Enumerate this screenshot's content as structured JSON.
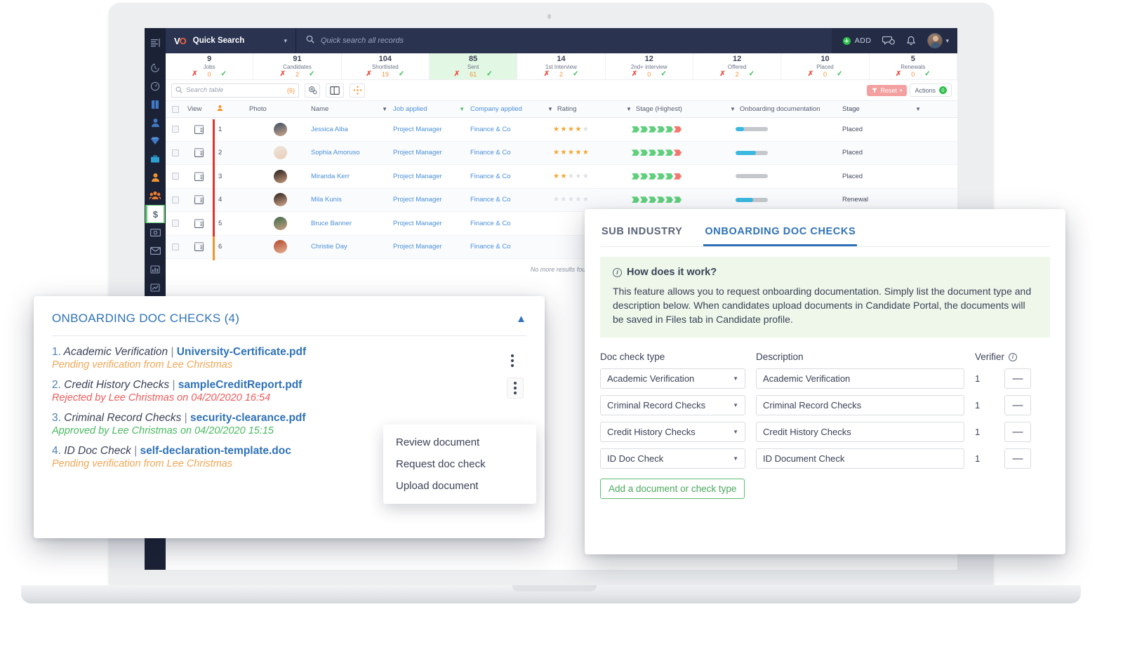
{
  "app": {
    "logo": "VO",
    "quick_search_label": "Quick Search",
    "quick_search_caret": "chevron-down-icon",
    "global_search_placeholder": "Quick search all records",
    "add_label": "ADD"
  },
  "sidebar": {
    "items": [
      {
        "name": "menu-toggle",
        "icon": "hamburger-icon"
      },
      {
        "name": "history",
        "icon": "clock-history-icon"
      },
      {
        "name": "dashboard",
        "icon": "speedometer-icon"
      },
      {
        "name": "jobs",
        "icon": "book-icon"
      },
      {
        "name": "contacts",
        "icon": "person-icon"
      },
      {
        "name": "deals",
        "icon": "diamond-icon"
      },
      {
        "name": "companies",
        "icon": "briefcase-icon"
      },
      {
        "name": "candidates",
        "icon": "person-orange-icon"
      },
      {
        "name": "teams",
        "icon": "people-group-icon"
      },
      {
        "name": "finance",
        "icon": "dollar-icon",
        "active": true
      },
      {
        "name": "payments",
        "icon": "money-icon"
      },
      {
        "name": "mail",
        "icon": "envelope-icon"
      },
      {
        "name": "reports",
        "icon": "bar-chart-icon"
      },
      {
        "name": "analytics",
        "icon": "line-chart-icon"
      },
      {
        "name": "settings",
        "icon": "gear-icon"
      }
    ]
  },
  "pipeline": [
    {
      "count": "9",
      "label": "Jobs",
      "mid": "0",
      "highlight": false
    },
    {
      "count": "91",
      "label": "Candidates",
      "mid": "2",
      "highlight": false
    },
    {
      "count": "104",
      "label": "Shortlisted",
      "mid": "19",
      "highlight": false
    },
    {
      "count": "85",
      "label": "Sent",
      "mid": "61",
      "highlight": true
    },
    {
      "count": "14",
      "label": "1st Interview",
      "mid": "2",
      "highlight": false
    },
    {
      "count": "12",
      "label": "2nd+ interview",
      "mid": "0",
      "highlight": false
    },
    {
      "count": "12",
      "label": "Offered",
      "mid": "2",
      "highlight": false
    },
    {
      "count": "10",
      "label": "Placed",
      "mid": "0",
      "highlight": false
    },
    {
      "count": "5",
      "label": "Renewals",
      "mid": "0",
      "highlight": false
    }
  ],
  "table_toolbar": {
    "search_placeholder": "Search table",
    "filter_count": "(6)",
    "settings_icon": "gear-cogs-icon",
    "columns_icon": "columns-layout-icon",
    "expand_icon": "expand-arrows-icon",
    "reset_label": "Reset",
    "reset_caret": "chevron-down-icon",
    "actions_label": "Actions",
    "actions_count": "0"
  },
  "table": {
    "columns": [
      "",
      "View",
      "",
      "Photo",
      "Name",
      "Job applied",
      "Company applied",
      "Rating",
      "Stage (Highest)",
      "Onboarding documentation",
      "Stage"
    ],
    "rows": [
      {
        "num": "1",
        "name": "Jessica Alba",
        "job": "Project Manager",
        "company": "Finance & Co",
        "rating": 4,
        "stage_green": 5,
        "stage_red": 1,
        "onboard": 25,
        "stage": "Placed",
        "bar": "red"
      },
      {
        "num": "2",
        "name": "Sophia Amoruso",
        "job": "Project Manager",
        "company": "Finance & Co",
        "rating": 5,
        "stage_green": 5,
        "stage_red": 1,
        "onboard": 62,
        "stage": "Placed",
        "bar": "red"
      },
      {
        "num": "3",
        "name": "Miranda Kerr",
        "job": "Project Manager",
        "company": "Finance & Co",
        "rating": 1.5,
        "stage_green": 5,
        "stage_red": 1,
        "onboard": 0,
        "stage": "Placed",
        "bar": "red"
      },
      {
        "num": "4",
        "name": "Mila Kunis",
        "job": "Project Manager",
        "company": "Finance & Co",
        "rating": 0,
        "stage_green": 6,
        "stage_red": 0,
        "onboard": 55,
        "stage": "Renewal",
        "bar": "red"
      },
      {
        "num": "5",
        "name": "Bruce Banner",
        "job": "Project Manager",
        "company": "Finance & Co",
        "rating": 0,
        "stage_green": 0,
        "stage_red": 0,
        "onboard": 0,
        "stage": "",
        "bar": "red"
      },
      {
        "num": "6",
        "name": "Christie Day",
        "job": "Project Manager",
        "company": "Finance & Co",
        "rating": 0,
        "stage_green": 0,
        "stage_red": 0,
        "onboard": 0,
        "stage": "",
        "bar": "orange"
      }
    ],
    "footer_note": "No more results found"
  },
  "doc_checks_panel": {
    "title": "ONBOARDING DOC CHECKS (4)",
    "collapse_icon": "chevron-up-icon",
    "items": [
      {
        "num": "1.",
        "type": "Academic Verification",
        "file": "University-Certificate.pdf",
        "status": "Pending verification from Lee Christmas",
        "status_kind": "pending"
      },
      {
        "num": "2.",
        "type": "Credit History Checks",
        "file": "sampleCreditReport.pdf",
        "status": "Rejected by Lee Christmas on 04/20/2020 16:54",
        "status_kind": "rejected"
      },
      {
        "num": "3.",
        "type": "Criminal Record Checks",
        "file": "security-clearance.pdf",
        "status": "Approved by Lee Christmas on 04/20/2020 15:15",
        "status_kind": "approved"
      },
      {
        "num": "4.",
        "type": "ID Doc Check",
        "file": "self-declaration-template.doc",
        "status": "Pending verification from Lee Christmas",
        "status_kind": "pending"
      }
    ],
    "context_menu": [
      "Review document",
      "Request doc check",
      "Upload document"
    ]
  },
  "settings_panel": {
    "tabs": [
      {
        "label": "SUB INDUSTRY",
        "active": false
      },
      {
        "label": "ONBOARDING DOC CHECKS",
        "active": true
      }
    ],
    "info": {
      "title": "How does it work?",
      "icon": "info-circle-icon",
      "body": "This feature allows you to request onboarding documentation. Simply list the document type and description below. When candidates upload documents in Candidate Portal, the documents will be saved in Files tab in Candidate profile."
    },
    "headers": {
      "type": "Doc check type",
      "description": "Description",
      "verifier": "Verifier",
      "verifier_icon": "info-circle-icon"
    },
    "rows": [
      {
        "type": "Academic Verification",
        "description": "Academic Verification",
        "verifier": "1",
        "remove": "—"
      },
      {
        "type": "Criminal Record Checks",
        "description": "Criminal Record Checks",
        "verifier": "1",
        "remove": "—"
      },
      {
        "type": "Credit History Checks",
        "description": "Credit History Checks",
        "verifier": "1",
        "remove": "—"
      },
      {
        "type": "ID Doc Check",
        "description": "ID Document Check",
        "verifier": "1",
        "remove": "—"
      }
    ],
    "add_button": "Add a document or check type"
  },
  "colors": {
    "brand_blue": "#2f72b8",
    "nav_dark": "#232b45",
    "sidebar_dark": "#1b2236",
    "green": "#5fcf7c",
    "red": "#f4776e",
    "orange": "#f0a757",
    "progress_blue": "#3bb8e0"
  }
}
